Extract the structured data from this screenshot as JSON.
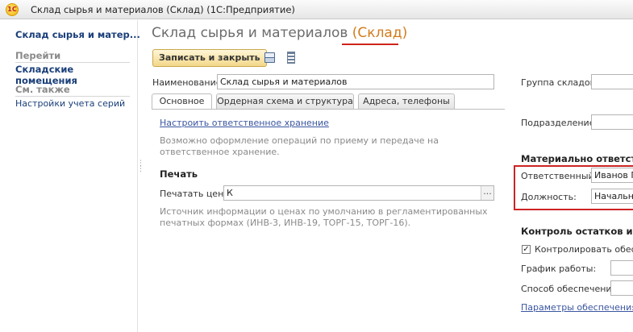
{
  "window": {
    "app_icon_text": "1C",
    "title": "Склад сырья и материалов (Склад)  (1С:Предприятие)"
  },
  "left_panel": {
    "heading": "Склад сырья и матер...",
    "section_goto": "Перейти",
    "goto_items": [
      "Складские помещения"
    ],
    "section_see_also": "См. также",
    "see_also_items": [
      "Настройки учета серий"
    ]
  },
  "main": {
    "title_main": "Склад сырья и материалов",
    "title_accent": "(Склад)",
    "toolbar": {
      "save_close_label": "Записать и закрыть"
    },
    "name_label": "Наименование:",
    "name_value": "Склад сырья и материалов",
    "group_label": "Группа складов:",
    "tabs": [
      "Основное",
      "Ордерная схема и структура",
      "Адреса, телефоны"
    ],
    "setup_link": "Настроить ответственное хранение",
    "setup_hint": "Возможно оформление операций по приему и передаче на ответственное хранение.",
    "print_section": "Печать",
    "print_prices_label": "Печатать цены:",
    "print_prices_value": "К",
    "print_hint": "Источник информации о ценах по умолчанию в регламентированных печатных формах (ИНВ-3, ИНВ-19, ТОРГ-15, ТОРГ-16).",
    "subdivision_label": "Подразделение:",
    "mat_resp_section": "Материально ответстве",
    "responsible_label": "Ответственный:",
    "responsible_value": "Иванов П",
    "position_label": "Должность:",
    "position_value": "Начальни",
    "control_section": "Контроль остатков и уп",
    "control_checkbox_label": "Контролировать обеспеч",
    "control_checked": true,
    "schedule_label": "График работы:",
    "supply_method_label": "Способ обеспечения:",
    "supply_params_link": "Параметры обеспечения по"
  }
}
